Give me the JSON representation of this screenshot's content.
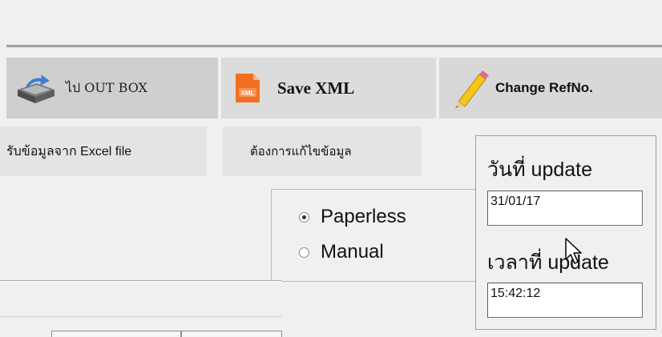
{
  "toolbar": {
    "outbox": {
      "label": "ไป OUT BOX",
      "icon": "outbox-tray-icon"
    },
    "save_xml": {
      "label": "Save XML",
      "icon": "xml-file-icon",
      "icon_text": "XML"
    },
    "change_ref": {
      "label": "Change RefNo.",
      "icon": "pencil-icon"
    }
  },
  "subtoolbar": {
    "excel": {
      "label": "รับข้อมูลจาก Excel file"
    },
    "edit": {
      "label": "ต้องการแก้ไขข้อมูล"
    }
  },
  "mode": {
    "options": [
      {
        "label": "Paperless",
        "checked": true
      },
      {
        "label": "Manual",
        "checked": false
      }
    ]
  },
  "update": {
    "date_label": "วันที่ update",
    "date_value": "31/01/17",
    "time_label": "เวลาที่ update",
    "time_value": "15:42:12"
  },
  "colors": {
    "xml_icon": "#f26f21",
    "pencil_body": "#f5c518",
    "pencil_tip": "#c94f1e"
  }
}
